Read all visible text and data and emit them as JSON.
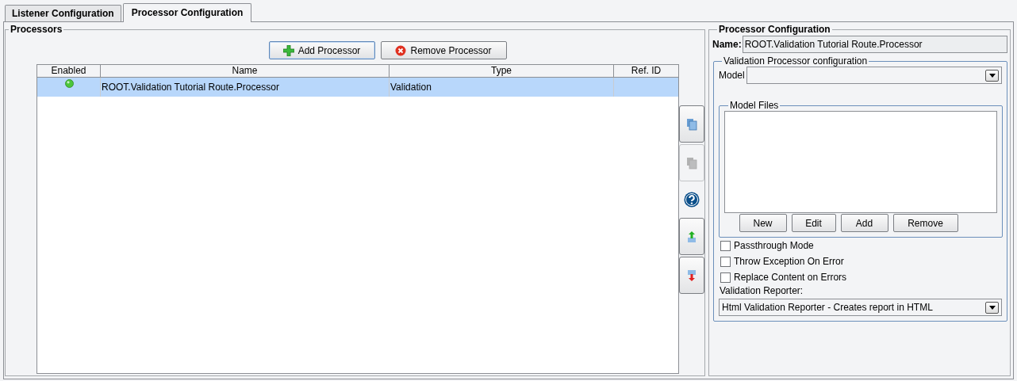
{
  "tabs": [
    {
      "label": "Listener Configuration",
      "selected": false
    },
    {
      "label": "Processor Configuration",
      "selected": true
    }
  ],
  "processors": {
    "title": "Processors",
    "buttons": [
      {
        "label": "Add Processor",
        "kind": "add"
      },
      {
        "label": "Remove Processor",
        "kind": "remove"
      }
    ],
    "table": {
      "columns": [
        "Enabled",
        "Name",
        "Type",
        "Ref. ID"
      ],
      "rows": [
        {
          "enabled": true,
          "name": "ROOT.Validation Tutorial Route.Processor",
          "type": "Validation",
          "selected": true
        }
      ]
    },
    "side_buttons": [
      {
        "kind": "copy",
        "disabled": false
      },
      {
        "kind": "paste",
        "disabled": true
      },
      {
        "kind": "help"
      },
      {
        "kind": "up",
        "disabled": false
      },
      {
        "kind": "down",
        "disabled": false
      }
    ]
  },
  "config": {
    "title": "Processor Configuration",
    "name_label": "Name:",
    "name_value": "ROOT.Validation Tutorial Route.Processor",
    "validation": {
      "title": "Validation Processor configuration",
      "model_label": "Model",
      "model_files": {
        "title": "Model Files",
        "buttons": [
          "New",
          "Edit",
          "Add",
          "Remove"
        ]
      },
      "options": [
        {
          "label": "Passthrough Mode",
          "checked": false
        },
        {
          "label": "Throw Exception On Error",
          "checked": false
        },
        {
          "label": "Replace Content on Errors",
          "checked": false
        }
      ],
      "reporter_label": "Validation Reporter:",
      "reporter_value": "Html Validation Reporter - Creates report in HTML"
    }
  }
}
